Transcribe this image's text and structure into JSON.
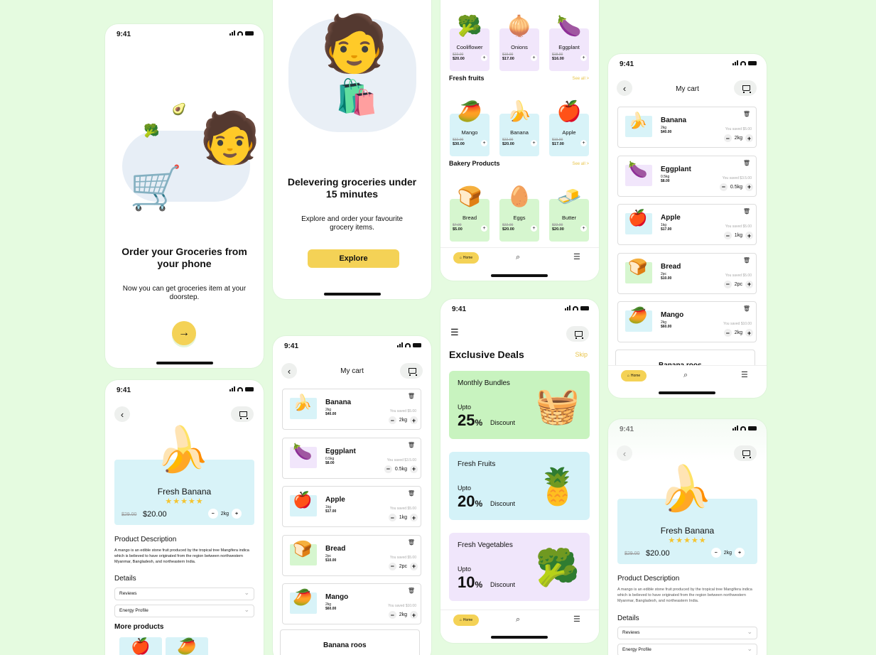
{
  "status_time": "9:41",
  "onb1": {
    "title": "Order your Groceries from your phone",
    "subtitle": "Now you can get groceries item at your doorstep.",
    "next_icon": "arrow-right-icon"
  },
  "onb2": {
    "title": "Delevering groceries under 15 minutes",
    "subtitle": "Explore and order your favourite grocery items.",
    "cta": "Explore"
  },
  "home": {
    "top_items": [
      {
        "name": "Cooliflower",
        "old": "$22.00",
        "price": "$20.00",
        "emoji": "🥦",
        "bg": "#f1e6fb"
      },
      {
        "name": "Onions",
        "old": "$19.00",
        "price": "$17.00",
        "emoji": "🧅",
        "bg": "#f1e6fb"
      },
      {
        "name": "Eggplant",
        "old": "$18.00",
        "price": "$16.00",
        "emoji": "🍆",
        "bg": "#f1e6fb"
      }
    ],
    "fruits_title": "Fresh fruits",
    "see_all": "See all >",
    "fruits": [
      {
        "name": "Mango",
        "old": "$32.00",
        "price": "$30.00",
        "emoji": "🥭",
        "bg": "#d8f3f8"
      },
      {
        "name": "Banana",
        "old": "$22.00",
        "price": "$20.00",
        "emoji": "🍌",
        "bg": "#d8f3f8"
      },
      {
        "name": "Apple",
        "old": "$19.00",
        "price": "$17.00",
        "emoji": "🍎",
        "bg": "#d8f3f8"
      }
    ],
    "bakery_title": "Bakery Products",
    "bakery": [
      {
        "name": "Bread",
        "old": "$7.00",
        "price": "$5.00",
        "emoji": "🍞",
        "bg": "#d6f6cf"
      },
      {
        "name": "Eggs",
        "old": "$22.00",
        "price": "$20.00",
        "emoji": "🥚",
        "bg": "#d6f6cf"
      },
      {
        "name": "Butter",
        "old": "$22.00",
        "price": "$20.00",
        "emoji": "🧈",
        "bg": "#d6f6cf"
      }
    ],
    "nav_home": "Home"
  },
  "cart": {
    "title": "My cart",
    "items": [
      {
        "name": "Banana",
        "qty": "2kg",
        "price": "$40.00",
        "saved": "You saved $5.00",
        "step": "2kg",
        "emoji": "🍌",
        "bg": "#d8f3f8"
      },
      {
        "name": "Eggplant",
        "qty": "0.5kg",
        "price": "$8.00",
        "saved": "You saved $3.5.00",
        "step": "0.5kg",
        "emoji": "🍆",
        "bg": "#f1e6fb"
      },
      {
        "name": "Apple",
        "qty": "1kg",
        "price": "$17.00",
        "saved": "You saved $5.00",
        "step": "1kg",
        "emoji": "🍎",
        "bg": "#d8f3f8"
      },
      {
        "name": "Bread",
        "qty": "2pc",
        "price": "$10.00",
        "saved": "You saved $5.00",
        "step": "2pc",
        "emoji": "🍞",
        "bg": "#d6f6cf"
      },
      {
        "name": "Mango",
        "qty": "2kg",
        "price": "$60.00",
        "saved": "You saved $10.00",
        "step": "2kg",
        "emoji": "🥭",
        "bg": "#d8f3f8"
      }
    ],
    "partial_item": "Banana roos"
  },
  "product": {
    "name": "Fresh Banana",
    "stars": "★★★★★",
    "old": "$29.00",
    "price": "$20.00",
    "step": "2kg",
    "desc_title": "Product Description",
    "desc": "A mango is an edible stone fruit produced by the tropical tree Mangifera indica which is believed to have originated from the region between northwestern Myanmar, Bangladesh, and northeastern India.",
    "details": "Details",
    "reviews": "Reviews",
    "energy": "Energy Profile",
    "more": "More products"
  },
  "deals": {
    "title": "Exclusive Deals",
    "skip": "Skip",
    "items": [
      {
        "name": "Monthly Bundles",
        "upto": "Upto",
        "pct": "25",
        "unit": "%",
        "disc": "Discount",
        "emoji": "🧺",
        "bg": "#c8f3bf"
      },
      {
        "name": "Fresh Fruits",
        "upto": "Upto",
        "pct": "20",
        "unit": "%",
        "disc": "Discount",
        "emoji": "🍍",
        "bg": "#d4f2f8"
      },
      {
        "name": "Fresh Vegetables",
        "upto": "Upto",
        "pct": "10",
        "unit": "%",
        "disc": "Discount",
        "emoji": "🥦",
        "bg": "#f0e6fb"
      }
    ]
  }
}
